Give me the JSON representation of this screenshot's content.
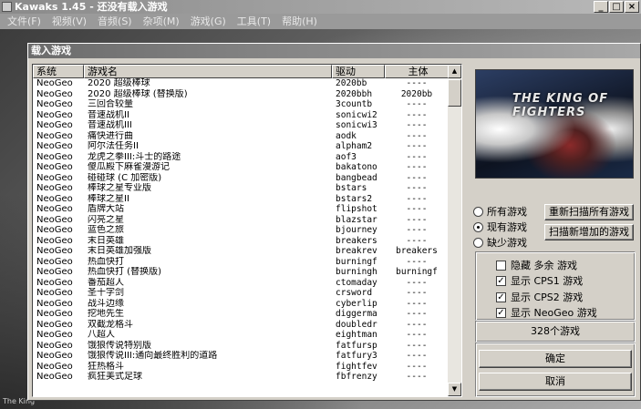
{
  "window": {
    "title": "Kawaks 1.45 - 还没有载入游戏"
  },
  "menu": [
    "文件(F)",
    "视频(V)",
    "音频(S)",
    "杂项(M)",
    "游戏(G)",
    "工具(T)",
    "帮助(H)"
  ],
  "background": {
    "corner_text": "The King"
  },
  "dialog": {
    "title": "载入游戏",
    "columns": [
      "系统",
      "游戏名",
      "驱动",
      "主体"
    ],
    "rows": [
      [
        "NeoGeo",
        "2020 超级棒球",
        "2020bb",
        "----"
      ],
      [
        "NeoGeo",
        "2020 超级棒球 (替换版)",
        "2020bbh",
        "2020bb"
      ],
      [
        "NeoGeo",
        "三回合较量",
        "3countb",
        "----"
      ],
      [
        "NeoGeo",
        "音速战机II",
        "sonicwi2",
        "----"
      ],
      [
        "NeoGeo",
        "音速战机III",
        "sonicwi3",
        "----"
      ],
      [
        "NeoGeo",
        "痛快进行曲",
        "aodk",
        "----"
      ],
      [
        "NeoGeo",
        "阿尔法任务II",
        "alpham2",
        "----"
      ],
      [
        "NeoGeo",
        "龙虎之拳III:斗士的路途",
        "aof3",
        "----"
      ],
      [
        "NeoGeo",
        "傻瓜殿下麻雀漫游记",
        "bakatono",
        "----"
      ],
      [
        "NeoGeo",
        "碰碰球 (C 加密版)",
        "bangbead",
        "----"
      ],
      [
        "NeoGeo",
        "棒球之星专业版",
        "bstars",
        "----"
      ],
      [
        "NeoGeo",
        "棒球之星II",
        "bstars2",
        "----"
      ],
      [
        "NeoGeo",
        "盾牌大站",
        "flipshot",
        "----"
      ],
      [
        "NeoGeo",
        "闪亮之星",
        "blazstar",
        "----"
      ],
      [
        "NeoGeo",
        "蓝色之旅",
        "bjourney",
        "----"
      ],
      [
        "NeoGeo",
        "末日英雄",
        "breakers",
        "----"
      ],
      [
        "NeoGeo",
        "末日英雄加强版",
        "breakrev",
        "breakers"
      ],
      [
        "NeoGeo",
        "热血快打",
        "burningf",
        "----"
      ],
      [
        "NeoGeo",
        "热血快打 (替换版)",
        "burningh",
        "burningf"
      ],
      [
        "NeoGeo",
        "番茄超人",
        "ctomaday",
        "----"
      ],
      [
        "NeoGeo",
        "圣十字剑",
        "crsword",
        "----"
      ],
      [
        "NeoGeo",
        "战斗边缘",
        "cyberlip",
        "----"
      ],
      [
        "NeoGeo",
        "挖地先生",
        "diggerma",
        "----"
      ],
      [
        "NeoGeo",
        "双截龙格斗",
        "doubledr",
        "----"
      ],
      [
        "NeoGeo",
        "八超人",
        "eightman",
        "----"
      ],
      [
        "NeoGeo",
        "饿狼传说特别版",
        "fatfursp",
        "----"
      ],
      [
        "NeoGeo",
        "饿狼传说III:通向最终胜利的道路",
        "fatfury3",
        "----"
      ],
      [
        "NeoGeo",
        "狂热格斗",
        "fightfev",
        "----"
      ],
      [
        "NeoGeo",
        "疯狂美式足球",
        "fbfrenzy",
        "----"
      ]
    ],
    "preview": {
      "logo_text": "THE KING OF FIGHTERS"
    },
    "radio": [
      {
        "label": "所有游戏",
        "checked": false
      },
      {
        "label": "现有游戏",
        "checked": true
      },
      {
        "label": "缺少游戏",
        "checked": false
      }
    ],
    "rescan_all_label": "重新扫描所有游戏",
    "scan_new_label": "扫描新增加的游戏",
    "checks": [
      {
        "label": "隐藏 多余 游戏",
        "checked": false
      },
      {
        "label": "显示 CPS1 游戏",
        "checked": true
      },
      {
        "label": "显示 CPS2 游戏",
        "checked": true
      },
      {
        "label": "显示 NeoGeo 游戏",
        "checked": true
      }
    ],
    "game_count": "328个游戏",
    "ok_label": "确定",
    "cancel_label": "取消"
  },
  "colors": {
    "titlebar": "#8a8a8a",
    "dialog_face": "#d4d0c8",
    "list_bg": "#ffffff"
  }
}
